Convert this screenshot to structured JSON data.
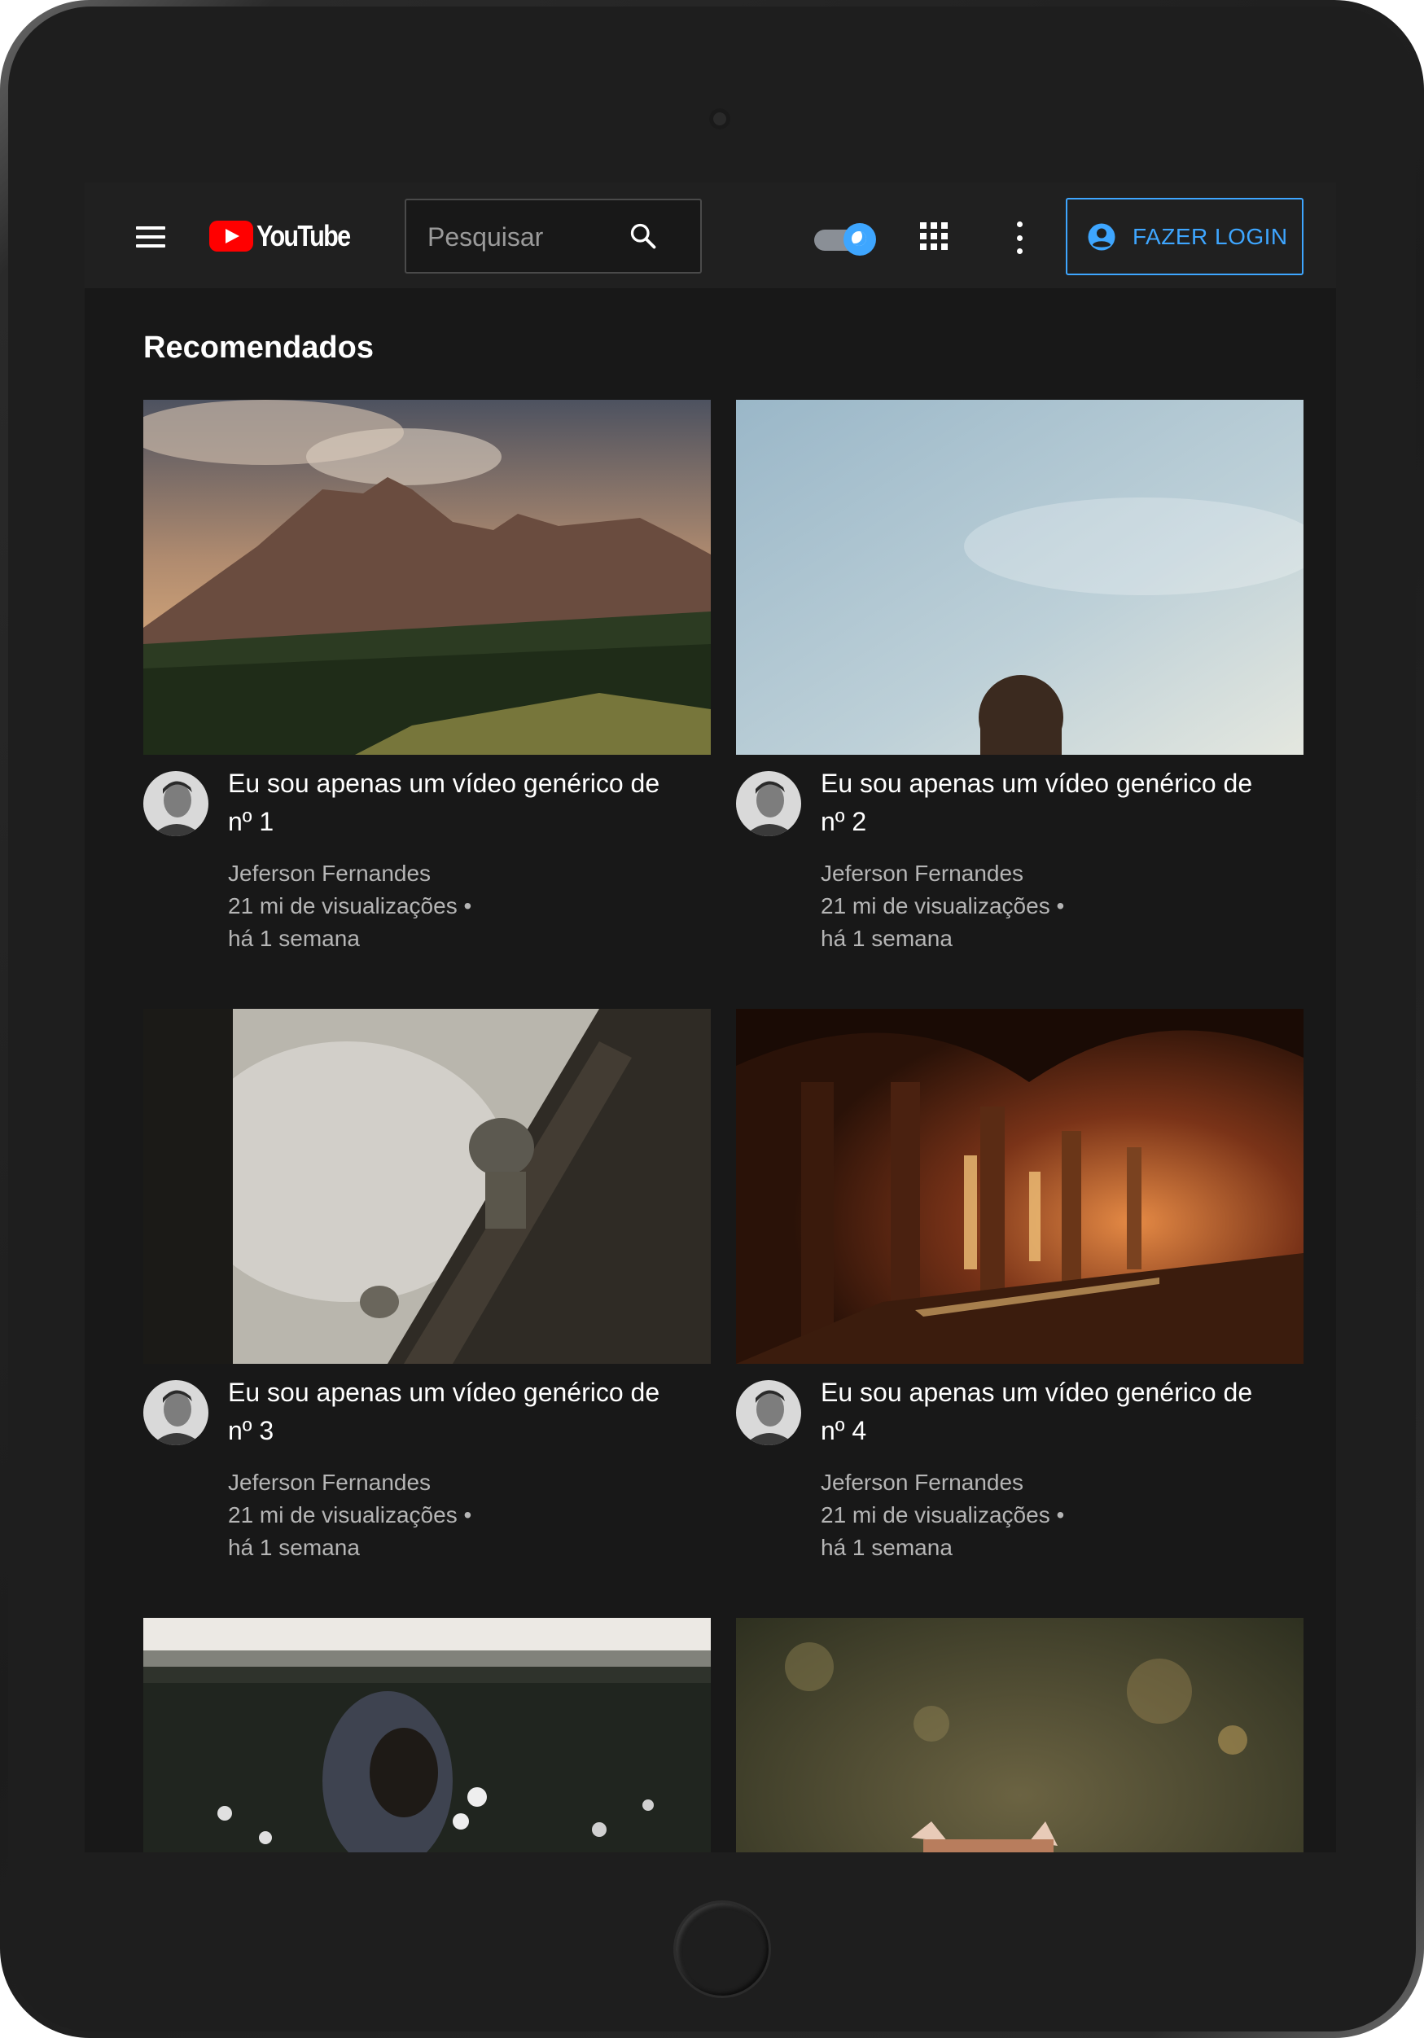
{
  "header": {
    "logo_text": "YouTube",
    "search_placeholder": "Pesquisar",
    "login_label": "FAZER LOGIN"
  },
  "main": {
    "section_title": "Recomendados",
    "videos": [
      {
        "title": "Eu sou apenas um vídeo genérico de nº 1",
        "channel": "Jeferson Fernandes",
        "views": "21 mi de visualizações •",
        "age": "há 1 semana"
      },
      {
        "title": "Eu sou apenas um vídeo genérico de nº 2",
        "channel": "Jeferson Fernandes",
        "views": "21 mi de visualizações •",
        "age": "há 1 semana"
      },
      {
        "title": "Eu sou apenas um vídeo genérico de nº 3",
        "channel": "Jeferson Fernandes",
        "views": "21 mi de visualizações •",
        "age": "há 1 semana"
      },
      {
        "title": "Eu sou apenas um vídeo genérico de nº 4",
        "channel": "Jeferson Fernandes",
        "views": "21 mi de visualizações •",
        "age": "há 1 semana"
      }
    ]
  },
  "theme": {
    "accent": "#3ea6ff",
    "background": "#181818",
    "header_bg": "#202020",
    "logo_red": "#ff0000"
  },
  "icons": [
    "menu-icon",
    "youtube-logo-icon",
    "search-icon",
    "dark-mode-toggle",
    "apps-grid-icon",
    "more-vertical-icon",
    "account-circle-icon"
  ]
}
